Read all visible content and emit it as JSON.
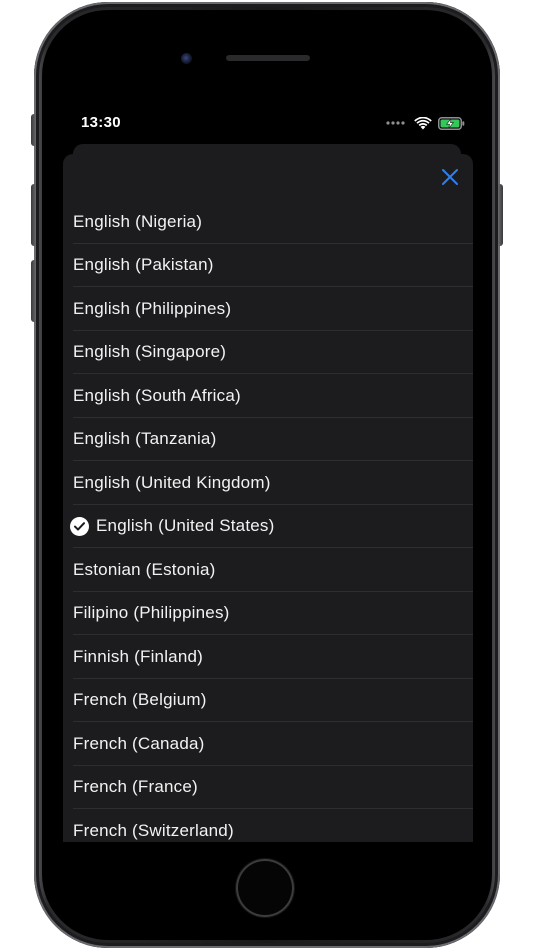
{
  "status_bar": {
    "time": "13:30"
  },
  "colors": {
    "accent": "#2f80ed",
    "sheet_background": "#1c1c1e",
    "text": "#f2f2f2",
    "separator": "#2e2e31",
    "battery": "#34c759"
  },
  "icons": {
    "close": "close-icon",
    "selected": "checkmark-circle-icon",
    "wifi": "wifi-icon",
    "battery": "battery-charging-icon",
    "signal": "cellular-signal-icon"
  },
  "languages": [
    {
      "label": "English (Nigeria)",
      "selected": false
    },
    {
      "label": "English (Pakistan)",
      "selected": false
    },
    {
      "label": "English (Philippines)",
      "selected": false
    },
    {
      "label": "English (Singapore)",
      "selected": false
    },
    {
      "label": "English (South Africa)",
      "selected": false
    },
    {
      "label": "English (Tanzania)",
      "selected": false
    },
    {
      "label": "English (United Kingdom)",
      "selected": false
    },
    {
      "label": "English (United States)",
      "selected": true
    },
    {
      "label": "Estonian (Estonia)",
      "selected": false
    },
    {
      "label": "Filipino (Philippines)",
      "selected": false
    },
    {
      "label": "Finnish (Finland)",
      "selected": false
    },
    {
      "label": "French (Belgium)",
      "selected": false
    },
    {
      "label": "French (Canada)",
      "selected": false
    },
    {
      "label": "French (France)",
      "selected": false
    },
    {
      "label": "French (Switzerland)",
      "selected": false
    }
  ]
}
